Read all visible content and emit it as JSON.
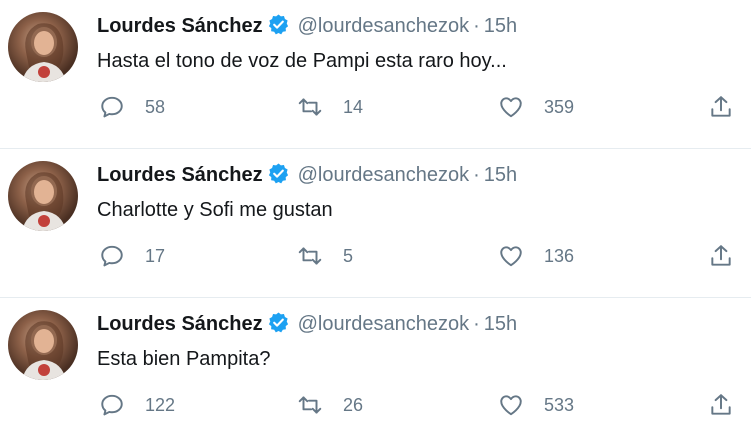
{
  "tweets": [
    {
      "author": {
        "name": "Lourdes Sánchez",
        "handle": "@lourdesanchezok",
        "verified": true
      },
      "separator": "·",
      "time": "15h",
      "text": "Hasta el tono de voz de Pampi esta raro hoy...",
      "replies": "58",
      "retweets": "14",
      "likes": "359"
    },
    {
      "author": {
        "name": "Lourdes Sánchez",
        "handle": "@lourdesanchezok",
        "verified": true
      },
      "separator": "·",
      "time": "15h",
      "text": "Charlotte y Sofi me gustan",
      "replies": "17",
      "retweets": "5",
      "likes": "136"
    },
    {
      "author": {
        "name": "Lourdes Sánchez",
        "handle": "@lourdesanchezok",
        "verified": true
      },
      "separator": "·",
      "time": "15h",
      "text": "Esta bien Pampita?",
      "replies": "122",
      "retweets": "26",
      "likes": "533"
    }
  ],
  "colors": {
    "verified": "#1da1f2",
    "muted": "#657786",
    "text": "#14171a",
    "divider": "#e6ecf0"
  },
  "icons": {
    "reply": "reply-icon",
    "retweet": "retweet-icon",
    "like": "heart-icon",
    "share": "share-icon",
    "verified": "verified-badge-icon"
  }
}
